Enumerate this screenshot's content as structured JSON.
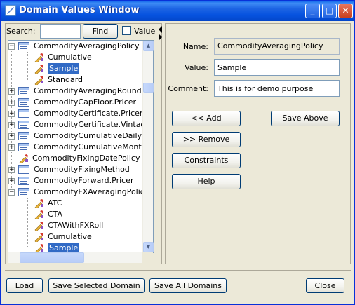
{
  "window": {
    "title": "Domain Values Window",
    "controls": {
      "minimize": "_",
      "maximize": "□",
      "close": "✕"
    }
  },
  "search": {
    "label": "Search:",
    "value": "",
    "find_label": "Find",
    "value_checkbox_label": "Value",
    "value_checked": false
  },
  "tree": {
    "items": [
      {
        "label": "CommodityAveragingPolicy",
        "kind": "domain",
        "expander": "minus"
      },
      {
        "label": "Cumulative",
        "kind": "value"
      },
      {
        "label": "Sample",
        "kind": "value",
        "selected": true
      },
      {
        "label": "Standard",
        "kind": "value"
      },
      {
        "label": "CommodityAveragingRoundingP",
        "kind": "domain",
        "expander": "plus"
      },
      {
        "label": "CommodityCapFloor.Pricer",
        "kind": "domain",
        "expander": "plus"
      },
      {
        "label": "CommodityCertificate.Pricer",
        "kind": "domain",
        "expander": "plus"
      },
      {
        "label": "CommodityCertificate.Vintage",
        "kind": "domain",
        "expander": "plus"
      },
      {
        "label": "CommodityCumulativeDailyFwdP",
        "kind": "domain",
        "expander": "plus"
      },
      {
        "label": "CommodityCumulativeMonthlyFu",
        "kind": "domain",
        "expander": "plus"
      },
      {
        "label": "CommodityFixingDatePolicy",
        "kind": "value-root"
      },
      {
        "label": "CommodityFixingMethod",
        "kind": "domain",
        "expander": "plus"
      },
      {
        "label": "CommodityForward.Pricer",
        "kind": "domain",
        "expander": "plus"
      },
      {
        "label": "CommodityFXAveragingPolicy",
        "kind": "domain",
        "expander": "minus"
      },
      {
        "label": "ATC",
        "kind": "value"
      },
      {
        "label": "CTA",
        "kind": "value"
      },
      {
        "label": "CTAWithFXRoll",
        "kind": "value"
      },
      {
        "label": "Cumulative",
        "kind": "value"
      },
      {
        "label": "Sample",
        "kind": "value",
        "selected": true
      }
    ]
  },
  "details": {
    "name_label": "Name:",
    "name_value": "CommodityAveragingPolicy",
    "value_label": "Value:",
    "value_value": "Sample",
    "comment_label": "Comment:",
    "comment_value": "This is for demo purpose"
  },
  "actions": {
    "add": "<< Add",
    "save_above": "Save Above",
    "remove": ">> Remove",
    "constraints": "Constraints",
    "help": "Help"
  },
  "footer": {
    "load": "Load",
    "save_selected": "Save Selected Domain",
    "save_all": "Save All Domains",
    "close": "Close"
  },
  "colors": {
    "titlebar": "#0653e0",
    "selection": "#316ac5",
    "window_bg": "#ece9d8"
  }
}
